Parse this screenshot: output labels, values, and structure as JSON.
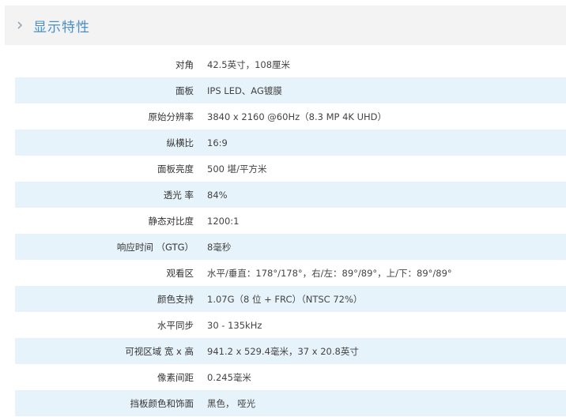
{
  "section": {
    "title": "显示特性",
    "icon": "chevron-right-icon"
  },
  "specs": [
    {
      "label": "对角",
      "value": "42.5英寸，108厘米"
    },
    {
      "label": "面板",
      "value": "IPS LED、AG镀膜"
    },
    {
      "label": "原始分辨率",
      "value": "3840 x 2160 @60Hz（8.3 MP 4K UHD）"
    },
    {
      "label": "纵横比",
      "value": "16:9"
    },
    {
      "label": "面板亮度",
      "value": "500 堪/平方米"
    },
    {
      "label": "透光 率",
      "value": "84%"
    },
    {
      "label": "静态对比度",
      "value": "1200:1"
    },
    {
      "label": "响应时间 （GTG）",
      "value": "8毫秒"
    },
    {
      "label": "观看区",
      "value": "水平/垂直：178°/178°，右/左：89°/89°，上/下：89°/89°"
    },
    {
      "label": "颜色支持",
      "value": "1.07G（8 位 + FRC）（NTSC 72%）"
    },
    {
      "label": "水平同步",
      "value": "30 - 135kHz"
    },
    {
      "label": "可视区域 宽 x 高",
      "value": "941.2 x 529.4毫米，37 x 20.8英寸"
    },
    {
      "label": "像素间距",
      "value": "0.245毫米"
    },
    {
      "label": "挡板颜色和饰面",
      "value": "黑色， 哑光"
    }
  ],
  "colors": {
    "accent": "#4a90c8",
    "header_bg": "#f3f3f3",
    "alt_row_bg": "#e7f3fb"
  }
}
